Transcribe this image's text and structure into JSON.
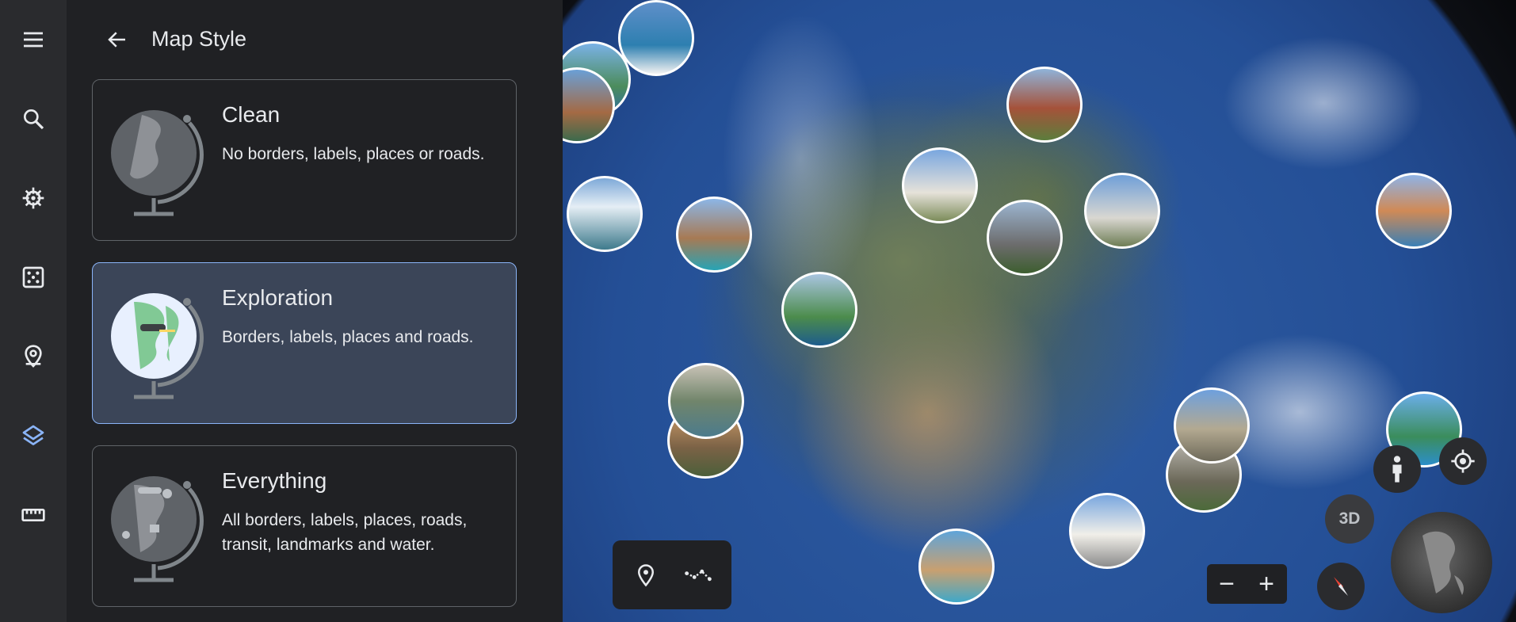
{
  "rail": {
    "items": [
      {
        "name": "menu",
        "icon": "menu-icon"
      },
      {
        "name": "search",
        "icon": "search-icon"
      },
      {
        "name": "voyager",
        "icon": "ship-wheel-icon"
      },
      {
        "name": "feeling-lucky",
        "icon": "dice-icon"
      },
      {
        "name": "projects",
        "icon": "location-pin-icon"
      },
      {
        "name": "map-style",
        "icon": "layers-icon",
        "active": true
      },
      {
        "name": "measure",
        "icon": "ruler-icon"
      }
    ],
    "active_color": "#8ab4f8",
    "icon_color": "#e8eaed"
  },
  "panel": {
    "title": "Map Style",
    "back_icon": "arrow-back-icon",
    "styles": [
      {
        "title": "Clean",
        "description": "No borders, labels, places or roads.",
        "selected": false
      },
      {
        "title": "Exploration",
        "description": "Borders, labels, places and roads.",
        "selected": true
      },
      {
        "title": "Everything",
        "description": "All borders, labels, places, roads, transit, landmarks and water.",
        "selected": false
      }
    ]
  },
  "map": {
    "toolbar": {
      "place_icon": "place-marker-icon",
      "path_icon": "line-path-icon"
    },
    "zoom_out_label": "−",
    "zoom_in_label": "+",
    "view_3d_label": "3D",
    "street_view_icon": "pegman-icon",
    "my_location_icon": "my-location-icon",
    "compass_icon": "compass-icon"
  }
}
